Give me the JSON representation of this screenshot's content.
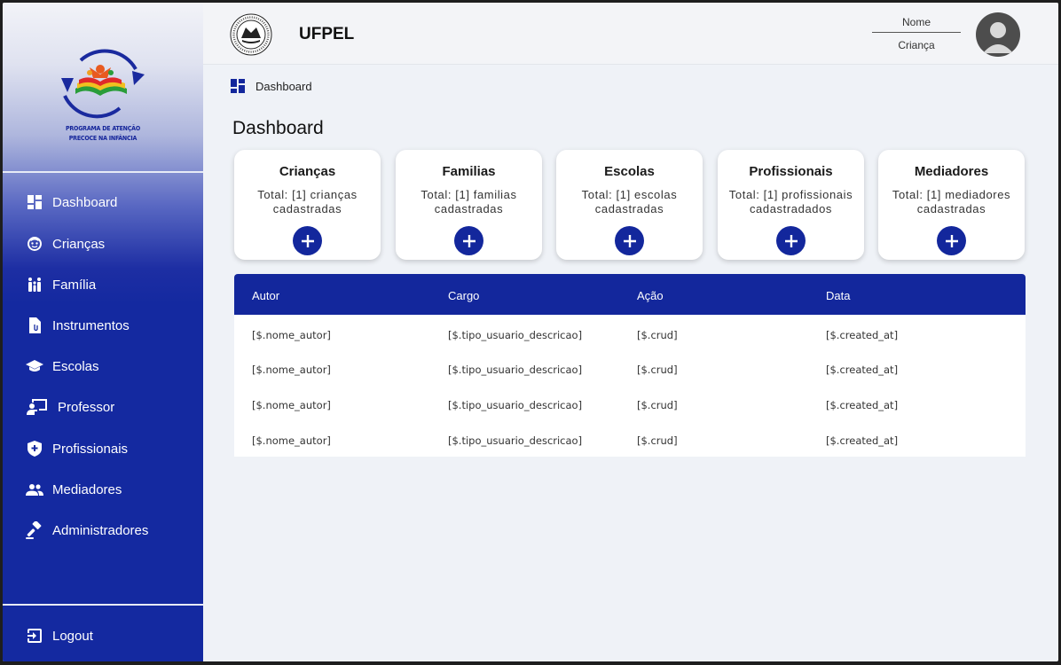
{
  "sidebar": {
    "logo_text_line1": "PROGRAMA DE ATENÇÃO",
    "logo_text_line2": "PRECOCE NA INFÂNCIA",
    "items": [
      {
        "label": "Dashboard",
        "icon": "dashboard-icon"
      },
      {
        "label": "Crianças",
        "icon": "child-face-icon"
      },
      {
        "label": "Família",
        "icon": "family-icon"
      },
      {
        "label": "Instrumentos",
        "icon": "document-icon"
      },
      {
        "label": "Escolas",
        "icon": "school-cap-icon"
      },
      {
        "label": "Professor",
        "icon": "teacher-icon"
      },
      {
        "label": "Profissionais",
        "icon": "shield-plus-icon"
      },
      {
        "label": "Mediadores",
        "icon": "group-icon"
      },
      {
        "label": "Administradores",
        "icon": "gavel-icon"
      }
    ],
    "logout": {
      "label": "Logout",
      "icon": "logout-icon"
    }
  },
  "header": {
    "brand": "UFPEL",
    "user_name": "Nome",
    "user_role": "Criança"
  },
  "breadcrumb": {
    "label": "Dashboard"
  },
  "page_title": "Dashboard",
  "cards": [
    {
      "title": "Crianças",
      "desc": "Total: [1] crianças cadastradas"
    },
    {
      "title": "Familias",
      "desc": "Total: [1] familias cadastradas"
    },
    {
      "title": "Escolas",
      "desc": "Total: [1] escolas cadastradas"
    },
    {
      "title": "Profissionais",
      "desc": "Total: [1] profissionais cadastradados"
    },
    {
      "title": "Mediadores",
      "desc": "Total: [1] mediadores cadastradas"
    }
  ],
  "table": {
    "columns": [
      "Autor",
      "Cargo",
      "Ação",
      "Data"
    ],
    "rows": [
      [
        "[$.nome_autor]",
        "[$.tipo_usuario_descricao]",
        "[$.crud]",
        "[$.created_at]"
      ],
      [
        "[$.nome_autor]",
        "[$.tipo_usuario_descricao]",
        "[$.crud]",
        "[$.created_at]"
      ],
      [
        "[$.nome_autor]",
        "[$.tipo_usuario_descricao]",
        "[$.crud]",
        "[$.created_at]"
      ],
      [
        "[$.nome_autor]",
        "[$.tipo_usuario_descricao]",
        "[$.crud]",
        "[$.created_at]"
      ]
    ]
  },
  "colors": {
    "primary": "#13279c",
    "background": "#eff2f7"
  }
}
